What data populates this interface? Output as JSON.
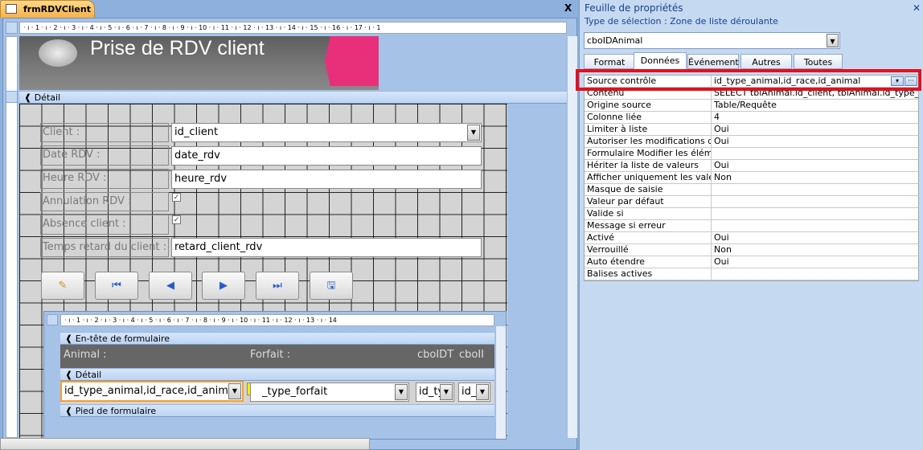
{
  "document_tab": {
    "title": "frmRDVClient",
    "close": "X"
  },
  "ruler_top": "· ı · 1 · ı · 2 · ı · 3 · ı · 4 · ı · 5 · ı · 6 · ı · 7 · ı · 8 · ı · 9 · ı · 10 · ı · 11 · ı · 12 · ı · 13 · ı · 14 · ı · 15 · ı · 16 · ı · 17 · ı · 1",
  "form": {
    "header_title": "Prise de RDV client",
    "detail_section": "Détail",
    "fields": [
      {
        "label": "Client :",
        "value": "id_client",
        "type": "combo"
      },
      {
        "label": "Date RDV :",
        "value": "date_rdv",
        "type": "text"
      },
      {
        "label": "Heure RDV :",
        "value": "heure_rdv",
        "type": "text"
      },
      {
        "label": "Annulation RDV :",
        "value": "",
        "type": "checkbox",
        "checked": true
      },
      {
        "label": "Absence client :",
        "value": "",
        "type": "checkbox",
        "checked": true
      },
      {
        "label": "Temps retard du client :",
        "value": "retard_client_rdv",
        "type": "text"
      }
    ],
    "buttons": [
      {
        "name": "edit",
        "icon": "pencil-icon",
        "glyph": "✎"
      },
      {
        "name": "first-record",
        "icon": "first-record-icon",
        "glyph": "⏮"
      },
      {
        "name": "previous-record",
        "icon": "previous-record-icon",
        "glyph": "◀"
      },
      {
        "name": "next-record",
        "icon": "next-record-icon",
        "glyph": "▶"
      },
      {
        "name": "last-record",
        "icon": "last-record-icon",
        "glyph": "⏭"
      },
      {
        "name": "save-record",
        "icon": "save-icon",
        "glyph": "🖫"
      }
    ]
  },
  "subform": {
    "ruler": "· ı · 1 · ı · 2 · ı · 3 · ı · 4 · ı · 5 · ı · 6 · ı · 7 · ı · 8 · ı · 9 · ı · 10 · ı · 11 · ı · 12 · ı · 13 · ı · 14",
    "header_section": "En-tête de formulaire",
    "header_labels": [
      "Animal :",
      "Forfait :",
      "cboIDT",
      "cboII"
    ],
    "detail_section": "Détail",
    "controls": [
      "id_type_animal,id_race,id_animal",
      "_type_forfait",
      "id_ty",
      "id_"
    ],
    "footer_section": "Pied de formulaire"
  },
  "property_sheet": {
    "title": "Feuille de propriétés",
    "close": "✕",
    "selection_type": "Type de sélection :  Zone de liste déroulante",
    "object": "cboIDAnimal",
    "tabs": [
      "Format",
      "Données",
      "Événement",
      "Autres",
      "Toutes"
    ],
    "active_tab": "Données",
    "rows": [
      {
        "k": "Source contrôle",
        "v": "id_type_animal,id_race,id_animal"
      },
      {
        "k": "Contenu",
        "v": "SELECT tblAnimal.id_client, tblAnimal.id_type_anim"
      },
      {
        "k": "Origine source",
        "v": "Table/Requête"
      },
      {
        "k": "Colonne liée",
        "v": "4"
      },
      {
        "k": "Limiter à liste",
        "v": "Oui"
      },
      {
        "k": "Autoriser les modifications de",
        "v": "Oui"
      },
      {
        "k": "Formulaire Modifier les éléme",
        "v": ""
      },
      {
        "k": "Hériter la liste de valeurs",
        "v": "Oui"
      },
      {
        "k": "Afficher uniquement les valeu",
        "v": "Non"
      },
      {
        "k": "Masque de saisie",
        "v": ""
      },
      {
        "k": "Valeur par défaut",
        "v": ""
      },
      {
        "k": "Valide si",
        "v": ""
      },
      {
        "k": "Message si erreur",
        "v": ""
      },
      {
        "k": "Activé",
        "v": "Oui"
      },
      {
        "k": "Verrouillé",
        "v": "Non"
      },
      {
        "k": "Auto étendre",
        "v": "Oui"
      },
      {
        "k": "Balises actives",
        "v": ""
      }
    ],
    "highlight_color": "#e3101e"
  }
}
